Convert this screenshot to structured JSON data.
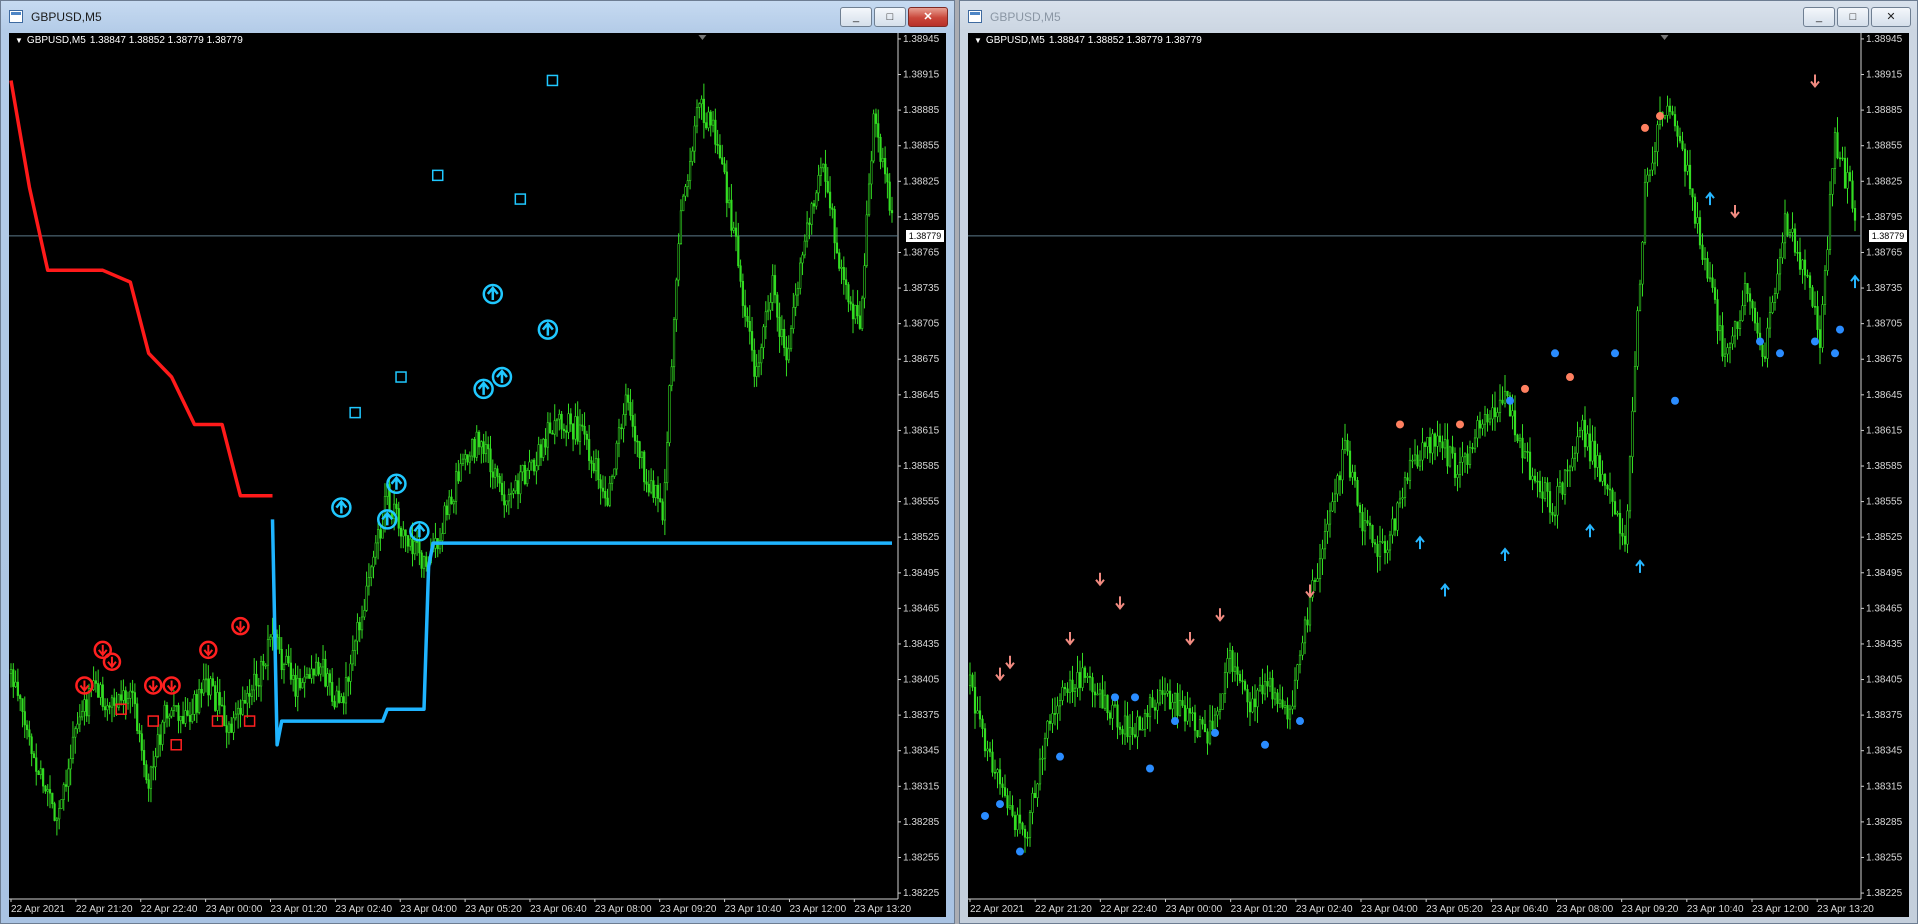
{
  "windows": [
    {
      "id": "left",
      "title": "GBPUSD,M5",
      "active": true,
      "header": {
        "symbol": "GBPUSD,M5",
        "ohlc": "1.38847 1.38852 1.38779 1.38779"
      },
      "current_price_label": "1.38779",
      "controls": {
        "minimize": "_",
        "maximize": "□",
        "close": "✕"
      },
      "indicator_lines": {
        "upper_color": "#ff1a1a",
        "lower_color": "#1fb4ff"
      }
    },
    {
      "id": "right",
      "title": "GBPUSD,M5",
      "active": false,
      "header": {
        "symbol": "GBPUSD,M5",
        "ohlc": "1.38847 1.38852 1.38779 1.38779"
      },
      "current_price_label": "1.38779",
      "controls": {
        "minimize": "_",
        "maximize": "□",
        "close": "✕"
      }
    }
  ],
  "colors": {
    "candle": "#33dd22",
    "grid_line": "#5c7a8a",
    "sell_marker": "#ff2020",
    "buy_marker": "#20c8ff",
    "arrow_up": "#26b6ff",
    "arrow_down": "#f08a80",
    "dot_up": "#2a8cff",
    "dot_down": "#ff8060"
  },
  "chart_data": [
    {
      "type": "candlestick",
      "title": "GBPUSD,M5",
      "x_tick_labels": [
        "22 Apr 2021",
        "22 Apr 21:20",
        "22 Apr 22:40",
        "23 Apr 00:00",
        "23 Apr 01:20",
        "23 Apr 02:40",
        "23 Apr 04:00",
        "23 Apr 05:20",
        "23 Apr 06:40",
        "23 Apr 08:00",
        "23 Apr 09:20",
        "23 Apr 10:40",
        "23 Apr 12:00",
        "23 Apr 13:20"
      ],
      "y_tick_labels": [
        "1.38945",
        "1.38915",
        "1.38885",
        "1.38855",
        "1.38825",
        "1.38795",
        "1.38765",
        "1.38735",
        "1.38705",
        "1.38675",
        "1.38645",
        "1.38615",
        "1.38585",
        "1.38555",
        "1.38525",
        "1.38495",
        "1.38465",
        "1.38435",
        "1.38405",
        "1.38375",
        "1.38345",
        "1.38315",
        "1.38285",
        "1.38255",
        "1.38225"
      ],
      "ylim": [
        1.3822,
        1.3895
      ],
      "current_price": 1.38779,
      "ohlc_last": {
        "open": 1.38847,
        "high": 1.38852,
        "low": 1.38779,
        "close": 1.38779
      },
      "close_series": {
        "points": [
          [
            0,
            1.3841
          ],
          [
            10,
            1.3834
          ],
          [
            20,
            1.3829
          ],
          [
            28,
            1.3836
          ],
          [
            36,
            1.384
          ],
          [
            44,
            1.3838
          ],
          [
            52,
            1.384
          ],
          [
            60,
            1.3832
          ],
          [
            68,
            1.3838
          ],
          [
            76,
            1.3837
          ],
          [
            86,
            1.384
          ],
          [
            96,
            1.3836
          ],
          [
            106,
            1.384
          ],
          [
            114,
            1.3844
          ],
          [
            124,
            1.384
          ],
          [
            134,
            1.3842
          ],
          [
            144,
            1.3838
          ],
          [
            156,
            1.3849
          ],
          [
            164,
            1.3856
          ],
          [
            172,
            1.3852
          ],
          [
            182,
            1.385
          ],
          [
            194,
            1.3857
          ],
          [
            204,
            1.3861
          ],
          [
            214,
            1.3856
          ],
          [
            226,
            1.3858
          ],
          [
            238,
            1.3863
          ],
          [
            250,
            1.3861
          ],
          [
            260,
            1.3856
          ],
          [
            268,
            1.3864
          ],
          [
            276,
            1.3858
          ],
          [
            284,
            1.3855
          ],
          [
            292,
            1.388
          ],
          [
            300,
            1.3889
          ],
          [
            308,
            1.3886
          ],
          [
            316,
            1.3877
          ],
          [
            324,
            1.3866
          ],
          [
            332,
            1.3874
          ],
          [
            338,
            1.3867
          ],
          [
            346,
            1.3878
          ],
          [
            354,
            1.3884
          ],
          [
            362,
            1.3875
          ],
          [
            370,
            1.387
          ],
          [
            376,
            1.3888
          ],
          [
            384,
            1.388
          ]
        ],
        "x_max": 384
      },
      "indicator_upper": [
        [
          0,
          1.3891
        ],
        [
          8,
          1.3882
        ],
        [
          16,
          1.3875
        ],
        [
          40,
          1.3875
        ],
        [
          52,
          1.3874
        ],
        [
          60,
          1.3868
        ],
        [
          70,
          1.3866
        ],
        [
          80,
          1.3862
        ],
        [
          92,
          1.3862
        ],
        [
          100,
          1.3856
        ],
        [
          114,
          1.3856
        ]
      ],
      "indicator_lower": [
        [
          114,
          1.3854
        ],
        [
          116,
          1.3835
        ],
        [
          118,
          1.3837
        ],
        [
          162,
          1.3837
        ],
        [
          164,
          1.3838
        ],
        [
          180,
          1.3838
        ],
        [
          182,
          1.385
        ],
        [
          184,
          1.3852
        ],
        [
          235,
          1.3852
        ]
      ],
      "sell_signals_circle": [
        [
          32,
          1.384
        ],
        [
          40,
          1.3843
        ],
        [
          44,
          1.3842
        ],
        [
          62,
          1.384
        ],
        [
          70,
          1.384
        ],
        [
          86,
          1.3843
        ],
        [
          100,
          1.3845
        ]
      ],
      "sell_signals_square": [
        [
          48,
          1.3838
        ],
        [
          62,
          1.3837
        ],
        [
          72,
          1.3835
        ],
        [
          90,
          1.3837
        ],
        [
          104,
          1.3837
        ]
      ],
      "buy_signals_circle": [
        [
          144,
          1.3855
        ],
        [
          164,
          1.3854
        ],
        [
          168,
          1.3857
        ],
        [
          178,
          1.3853
        ],
        [
          206,
          1.3865
        ],
        [
          214,
          1.3866
        ],
        [
          210,
          1.3873
        ],
        [
          234,
          1.387
        ]
      ],
      "buy_signals_square": [
        [
          150,
          1.3863
        ],
        [
          170,
          1.3866
        ],
        [
          186,
          1.3883
        ],
        [
          222,
          1.3881
        ],
        [
          236,
          1.3891
        ]
      ]
    },
    {
      "type": "candlestick",
      "title": "GBPUSD,M5",
      "x_tick_labels": [
        "22 Apr 2021",
        "22 Apr 21:20",
        "22 Apr 22:40",
        "23 Apr 00:00",
        "23 Apr 01:20",
        "23 Apr 02:40",
        "23 Apr 04:00",
        "23 Apr 05:20",
        "23 Apr 06:40",
        "23 Apr 08:00",
        "23 Apr 09:20",
        "23 Apr 10:40",
        "23 Apr 12:00",
        "23 Apr 13:20"
      ],
      "y_tick_labels": [
        "1.38945",
        "1.38915",
        "1.38885",
        "1.38855",
        "1.38825",
        "1.38795",
        "1.38765",
        "1.38735",
        "1.38705",
        "1.38675",
        "1.38645",
        "1.38615",
        "1.38585",
        "1.38555",
        "1.38525",
        "1.38495",
        "1.38465",
        "1.38435",
        "1.38405",
        "1.38375",
        "1.38345",
        "1.38315",
        "1.38285",
        "1.38255",
        "1.38225"
      ],
      "ylim": [
        1.3822,
        1.3895
      ],
      "current_price": 1.38779,
      "close_series": {
        "points": [
          [
            0,
            1.384
          ],
          [
            8,
            1.3834
          ],
          [
            16,
            1.3829
          ],
          [
            22,
            1.3827
          ],
          [
            30,
            1.3836
          ],
          [
            38,
            1.384
          ],
          [
            46,
            1.3841
          ],
          [
            56,
            1.3838
          ],
          [
            64,
            1.3836
          ],
          [
            72,
            1.3838
          ],
          [
            80,
            1.3839
          ],
          [
            88,
            1.3837
          ],
          [
            96,
            1.3836
          ],
          [
            104,
            1.3842
          ],
          [
            112,
            1.3838
          ],
          [
            120,
            1.384
          ],
          [
            128,
            1.3837
          ],
          [
            136,
            1.3847
          ],
          [
            142,
            1.3853
          ],
          [
            150,
            1.386
          ],
          [
            158,
            1.3853
          ],
          [
            166,
            1.3851
          ],
          [
            176,
            1.3858
          ],
          [
            186,
            1.3861
          ],
          [
            196,
            1.3858
          ],
          [
            206,
            1.3863
          ],
          [
            214,
            1.3864
          ],
          [
            224,
            1.3858
          ],
          [
            234,
            1.3855
          ],
          [
            244,
            1.3862
          ],
          [
            252,
            1.3858
          ],
          [
            262,
            1.3852
          ],
          [
            270,
            1.3882
          ],
          [
            278,
            1.3889
          ],
          [
            286,
            1.3884
          ],
          [
            294,
            1.3876
          ],
          [
            302,
            1.3867
          ],
          [
            310,
            1.3873
          ],
          [
            318,
            1.3868
          ],
          [
            326,
            1.3879
          ],
          [
            334,
            1.3875
          ],
          [
            340,
            1.3869
          ],
          [
            346,
            1.3886
          ],
          [
            354,
            1.388
          ]
        ],
        "x_max": 354
      },
      "arrows_down": [
        [
          12,
          1.3841
        ],
        [
          16,
          1.3842
        ],
        [
          40,
          1.3844
        ],
        [
          52,
          1.3849
        ],
        [
          60,
          1.3847
        ],
        [
          88,
          1.3844
        ],
        [
          100,
          1.3846
        ],
        [
          136,
          1.3848
        ],
        [
          306,
          1.388
        ],
        [
          338,
          1.3891
        ]
      ],
      "arrows_up": [
        [
          180,
          1.3852
        ],
        [
          190,
          1.3848
        ],
        [
          214,
          1.3851
        ],
        [
          248,
          1.3853
        ],
        [
          268,
          1.385
        ],
        [
          296,
          1.3881
        ],
        [
          354,
          1.3874
        ]
      ],
      "dots_up": [
        [
          6,
          1.3829
        ],
        [
          12,
          1.383
        ],
        [
          20,
          1.3826
        ],
        [
          36,
          1.3834
        ],
        [
          58,
          1.3839
        ],
        [
          66,
          1.3839
        ],
        [
          72,
          1.3833
        ],
        [
          82,
          1.3837
        ],
        [
          98,
          1.3836
        ],
        [
          118,
          1.3835
        ],
        [
          132,
          1.3837
        ],
        [
          216,
          1.3864
        ],
        [
          234,
          1.3868
        ],
        [
          258,
          1.3868
        ],
        [
          282,
          1.3864
        ],
        [
          316,
          1.3869
        ],
        [
          324,
          1.3868
        ],
        [
          338,
          1.3869
        ],
        [
          346,
          1.3868
        ],
        [
          348,
          1.387
        ]
      ],
      "dots_down": [
        [
          172,
          1.3862
        ],
        [
          196,
          1.3862
        ],
        [
          222,
          1.3865
        ],
        [
          240,
          1.3866
        ],
        [
          270,
          1.3887
        ],
        [
          276,
          1.3888
        ]
      ]
    }
  ]
}
